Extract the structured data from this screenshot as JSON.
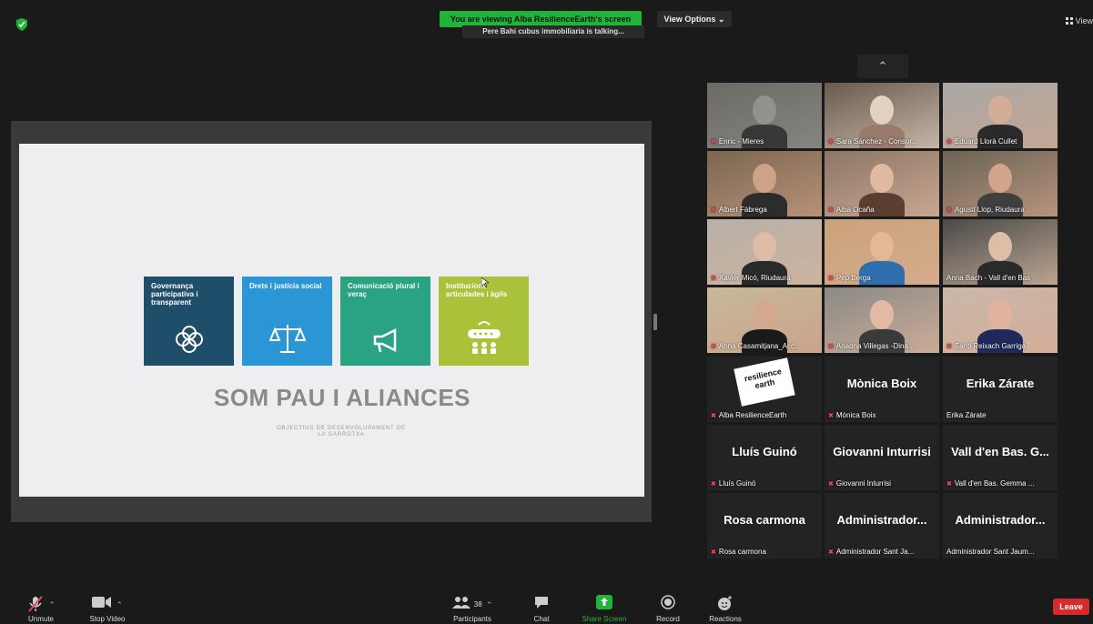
{
  "top": {
    "banner": "You are viewing Alba ResilienceEarth's screen",
    "talking": "Pere Bahi cubus immobiliaria is talking...",
    "view_options": "View Options ⌄",
    "view": "View"
  },
  "slide": {
    "cards": [
      {
        "text": "Governança participativa i transparent",
        "color": "#1f4e6b"
      },
      {
        "text": "Drets i justícia social",
        "color": "#2a96d6"
      },
      {
        "text": "Comunicació plural i veraç",
        "color": "#2aa383"
      },
      {
        "text": "Institucions articulades i àgils",
        "color": "#a9c23a"
      }
    ],
    "title": "SOM PAU I ALIANCES",
    "subtitle": "OBJECTIUS DE DESENVOLUPAMENT DE LA GARROTXA"
  },
  "gallery": [
    {
      "label": "Enric - Mieres",
      "muted": true
    },
    {
      "label": "Sara Sánchez - Consor...",
      "muted": true
    },
    {
      "label": "Eduard Llorà Cullet",
      "muted": true
    },
    {
      "label": "Albert Fàbrega",
      "muted": true
    },
    {
      "label": "Alba Ocaña",
      "muted": true
    },
    {
      "label": "Agustí Llop, Riudaura",
      "muted": true
    },
    {
      "label": "Xavier Micó, Riudaura",
      "muted": true
    },
    {
      "label": "Pep Berga",
      "muted": true
    },
    {
      "label": "Anna Bach - Vall d'en Bas",
      "muted": false
    },
    {
      "label": "Anna Casamitjana_Acc...",
      "muted": true
    },
    {
      "label": "Ariadna Villegas -Dina...",
      "muted": true
    },
    {
      "label": "Santi Reixach Garriga",
      "muted": true
    },
    {
      "label": "Alba ResilienceEarth",
      "muted": true,
      "logo": "resilience earth"
    },
    {
      "label": "Mònica Boix",
      "muted": true,
      "name": "Mònica Boix"
    },
    {
      "label": "Erika Zárate",
      "muted": false,
      "name": "Erika Zárate"
    },
    {
      "label": "Lluís Guinó",
      "muted": true,
      "name": "Lluís Guinó"
    },
    {
      "label": "Giovanni Inturrisi",
      "muted": true,
      "name": "Giovanni Inturrisi"
    },
    {
      "label": "Vall d'en Bas. Gemma ...",
      "muted": true,
      "name": "Vall d'en Bas. G..."
    },
    {
      "label": "Rosa carmona",
      "muted": true,
      "name": "Rosa carmona"
    },
    {
      "label": "Administrador Sant Ja...",
      "muted": true,
      "name": "Administrador..."
    },
    {
      "label": "Administrador Sant Jaum...",
      "muted": false,
      "name": "Administrador..."
    }
  ],
  "toolbar": {
    "unmute": "Unmute",
    "stop_video": "Stop Video",
    "participants": "Participants",
    "participants_count": "38",
    "chat": "Chat",
    "share_screen": "Share Screen",
    "record": "Record",
    "reactions": "Reactions",
    "leave": "Leave"
  },
  "colors": {
    "banner_green": "#20b53a",
    "share_green": "#20b53a",
    "leave_red": "#d62b2b",
    "muted_red": "#e5484d"
  }
}
